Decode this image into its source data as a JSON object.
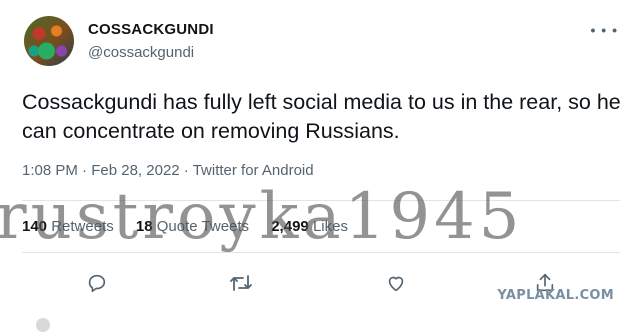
{
  "tweet": {
    "author_name": "COSSACKGUNDI",
    "handle": "@cossackgundi",
    "text": "Cossackgundi has fully left social media to us in the rear, so he can concentrate on removing Russians.",
    "time": "1:08 PM",
    "date": "Feb 28, 2022",
    "source": "Twitter for Android",
    "retweets_count": "140",
    "retweets_label": "Retweets",
    "quotes_count": "18",
    "quotes_label": "Quote Tweets",
    "likes_count": "2,499",
    "likes_label": "Likes",
    "more_icon_text": "• • •"
  },
  "actions": {
    "reply_icon": "reply-icon",
    "retweet_icon": "retweet-icon",
    "like_icon": "like-icon",
    "share_icon": "share-icon",
    "icon_color": "#536471"
  },
  "watermarks": {
    "overlay": "rustroyka1945",
    "corner": "YAPLAKAL.COM"
  }
}
